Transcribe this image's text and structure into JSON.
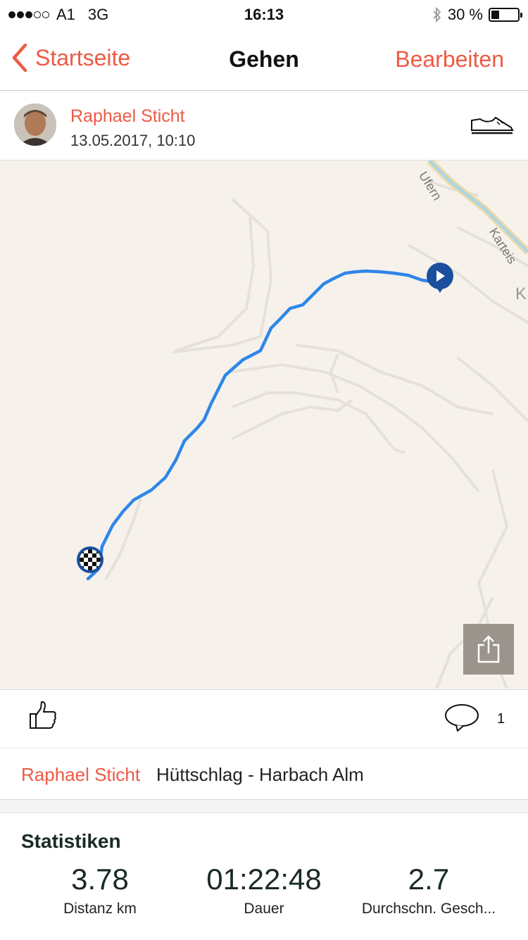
{
  "status_bar": {
    "carrier": "A1",
    "network": "3G",
    "time": "16:13",
    "battery": "30 %",
    "battery_level": 0.3,
    "signal_bars_on": 3,
    "signal_bars_total": 5
  },
  "nav": {
    "back_label": "Startseite",
    "title": "Gehen",
    "edit_label": "Bearbeiten"
  },
  "author": {
    "name": "Raphael Sticht",
    "date": "13.05.2017, 10:10",
    "activity_icon": "shoe-icon"
  },
  "map": {
    "labels": [
      "Ufern",
      "Karteis",
      "K"
    ],
    "route_color": "#2f86e8",
    "start_marker": "play-marker",
    "finish_marker": "checkered-flag-marker",
    "share_icon": "share-icon"
  },
  "actions": {
    "like_icon": "thumbs-up-icon",
    "comment_icon": "speech-bubble-icon",
    "comment_count": "1"
  },
  "tour": {
    "author": "Raphael Sticht",
    "name": "Hüttschlag - Harbach Alm"
  },
  "stats": {
    "title": "Statistiken",
    "items": [
      {
        "value": "3.78",
        "label": "Distanz km"
      },
      {
        "value": "01:22:48",
        "label": "Dauer"
      },
      {
        "value": "2.7",
        "label": "Durchschn. Gesch..."
      }
    ]
  },
  "colors": {
    "accent": "#ee5a44",
    "route": "#2f86e8",
    "marker": "#1b4f9c"
  }
}
